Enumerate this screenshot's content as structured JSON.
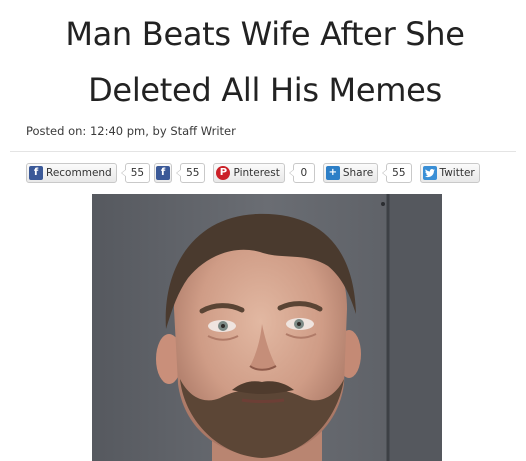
{
  "article": {
    "headline_line1": "Man Beats Wife After She",
    "headline_line2": "Deleted All His Memes",
    "byline": "Posted on: 12:40 pm, by Staff Writer"
  },
  "share_bar": {
    "recommend_label": "Recommend",
    "recommend_count": "55",
    "facebook_count": "55",
    "pinterest_label": "Pinterest",
    "pinterest_count": "0",
    "share_label": "Share",
    "share_count": "55",
    "twitter_label": "Twitter"
  },
  "icons": {
    "facebook": "facebook-icon",
    "pinterest": "pinterest-icon",
    "share": "plus-share-icon",
    "twitter": "twitter-bird-icon"
  },
  "colors": {
    "facebook": "#3b5998",
    "pinterest": "#cb2027",
    "share": "#2d7fc7",
    "twitter": "#3a8fd6",
    "photo_background": "#5f6268"
  }
}
